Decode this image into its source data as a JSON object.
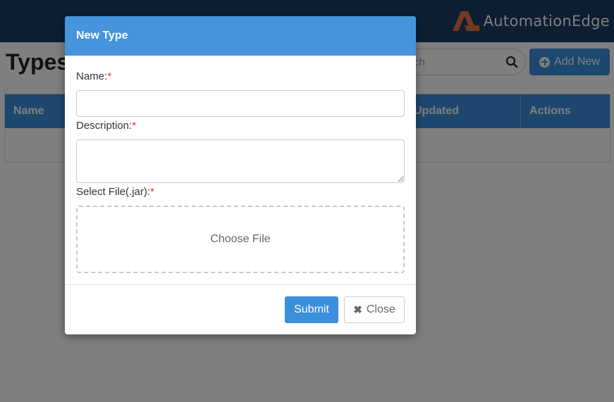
{
  "app": {
    "brand_name": "AutomationEdge",
    "brand_color": "#e8743b"
  },
  "page": {
    "title": "Types",
    "search_partial": "ch",
    "add_new_label": "Add New"
  },
  "table": {
    "columns": [
      "Name",
      "Updated",
      "Actions"
    ]
  },
  "modal": {
    "title": "New Type",
    "fields": {
      "name_label": "Name:",
      "description_label": "Description:",
      "file_label": "Select File(.jar):",
      "required_mark": "*",
      "name_value": "",
      "description_value": ""
    },
    "dropzone_text": "Choose File",
    "submit_label": "Submit",
    "close_label": "Close"
  },
  "colors": {
    "primary": "#3b8fdc",
    "header": "#4594dc",
    "topbar": "#1b3d66",
    "required": "#d9342b"
  }
}
